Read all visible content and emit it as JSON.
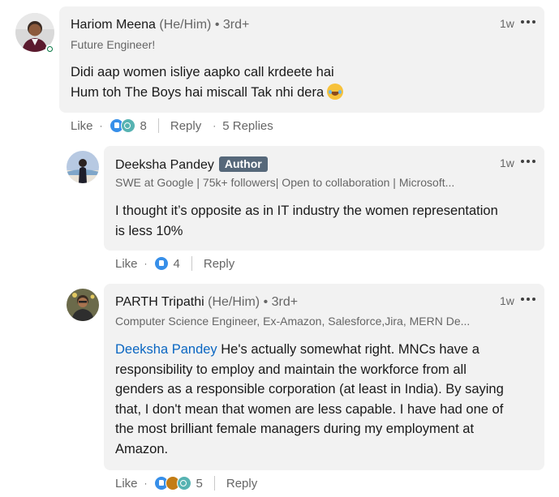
{
  "comment1": {
    "author": "Hariom Meena",
    "pronouns": "(He/Him)",
    "degree": "• 3rd+",
    "headline": "Future Engineer!",
    "time": "1w",
    "line1": "Didi aap women isliye aapko call krdeete hai",
    "line2": "Hum toh The Boys hai miscall Tak nhi dera",
    "like_label": "Like",
    "reaction_count": "8",
    "reply_label": "Reply",
    "replies_label": "5 Replies",
    "reaction_icons": [
      "like-icon",
      "funny-icon"
    ]
  },
  "reply1": {
    "author": "Deeksha Pandey",
    "badge": "Author",
    "headline": "SWE at Google | 75k+ followers| Open to collaboration | Microsoft...",
    "time": "1w",
    "line1": "I thought it’s opposite as in IT industry the women representation",
    "line2": "is less 10%",
    "like_label": "Like",
    "reaction_count": "4",
    "reply_label": "Reply",
    "reaction_icons": [
      "like-icon"
    ]
  },
  "reply2": {
    "author": "PARTH Tripathi",
    "pronouns": "(He/Him)",
    "degree": "• 3rd+",
    "headline": "Computer Science Engineer, Ex-Amazon, Salesforce,Jira, MERN De...",
    "time": "1w",
    "mention": "Deeksha Pandey",
    "line1_rest": " He's actually somewhat right. MNCs have a",
    "line2": "responsibility to employ and maintain the workforce from all",
    "line3": "genders as a responsible corporation (at least in India). By saying",
    "line4": "that, I don't mean that women are less capable. I have had one of",
    "line5": "the most brilliant female managers during my employment at",
    "line6": "Amazon.",
    "like_label": "Like",
    "reaction_count": "5",
    "reply_label": "Reply",
    "reaction_icons": [
      "like-icon",
      "support-icon",
      "funny-icon"
    ]
  },
  "colors": {
    "bubble": "#f2f2f2",
    "mention": "#0a66c2",
    "badge": "#56687a",
    "online": "#057642"
  }
}
